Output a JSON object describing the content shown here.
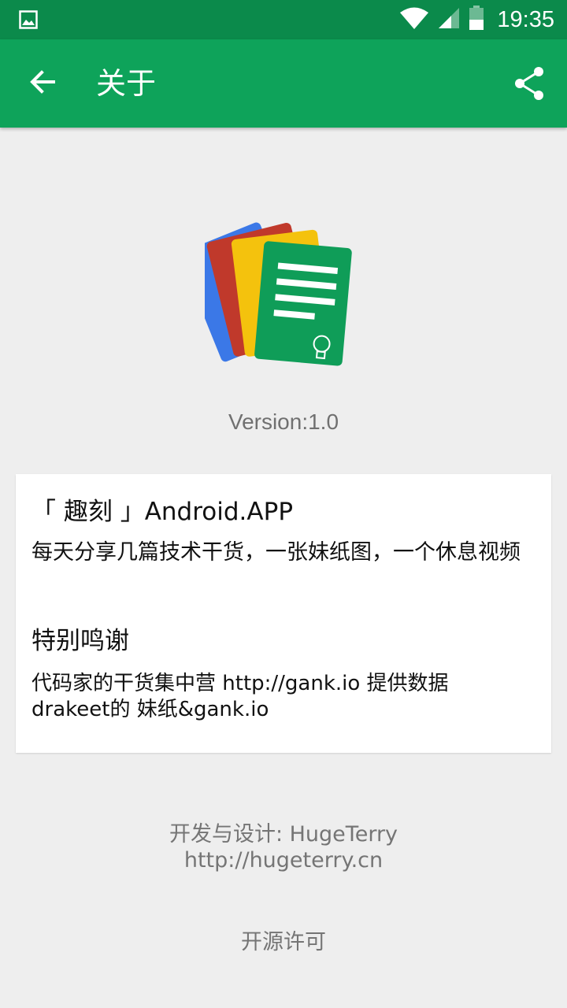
{
  "status_bar": {
    "time": "19:35",
    "icons": [
      "image-notification-icon",
      "wifi-icon",
      "cell-signal-icon",
      "battery-icon"
    ]
  },
  "toolbar": {
    "title": "关于",
    "back_icon": "arrow-left-icon",
    "share_icon": "share-icon",
    "color": "#0ea35a"
  },
  "app": {
    "logo_icon": "app-logo-icon",
    "version": "Version:1.0"
  },
  "card": {
    "title": "「 趣刻 」Android.APP",
    "description": "每天分享几篇技术干货，一张妹纸图，一个休息视频",
    "thanks_title": "特别鸣谢",
    "thanks_line1": "代码家的干货集中营 http://gank.io 提供数据",
    "thanks_line2": "drakeet的 妹纸&gank.io"
  },
  "footer": {
    "developer": "开发与设计: HugeTerry",
    "website": "http://hugeterry.cn",
    "license": "开源许可"
  }
}
